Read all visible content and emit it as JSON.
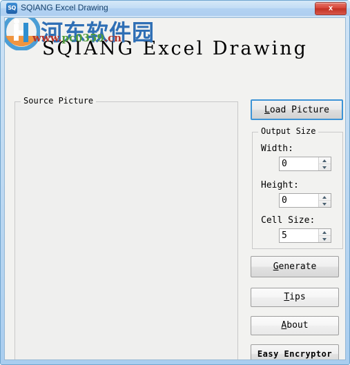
{
  "window": {
    "title": "SQIANG Excel Drawing",
    "app_icon_label": "SQ",
    "close_label": "x",
    "frame_color": "#6fa5cf",
    "titlebar_color": "#bfdaf2",
    "close_color": "#c23123"
  },
  "heading": {
    "text": "SQIANG Excel Drawing"
  },
  "watermark": {
    "site_name_cn": "河东软件园",
    "url_www": "www.",
    "url_domain": "pc0359",
    "url_tld": ".cn",
    "cn_color": "#2f6fb5",
    "url_red": "#b5342b",
    "url_green": "#4f9c3a"
  },
  "source_group": {
    "title": "Source Picture"
  },
  "output_group": {
    "title": "Output Size",
    "fields": [
      {
        "label": "Width:",
        "value": "0"
      },
      {
        "label": "Height:",
        "value": "0"
      },
      {
        "label": "Cell Size:",
        "value": "5"
      }
    ]
  },
  "buttons": {
    "load_picture": {
      "accel": "L",
      "rest": "oad Picture"
    },
    "generate": {
      "accel": "G",
      "rest": "enerate"
    },
    "tips": {
      "accel": "T",
      "rest": "ips"
    },
    "about": {
      "accel": "A",
      "rest": "bout"
    },
    "easy_encryptor": {
      "label": "Easy Encryptor"
    }
  }
}
